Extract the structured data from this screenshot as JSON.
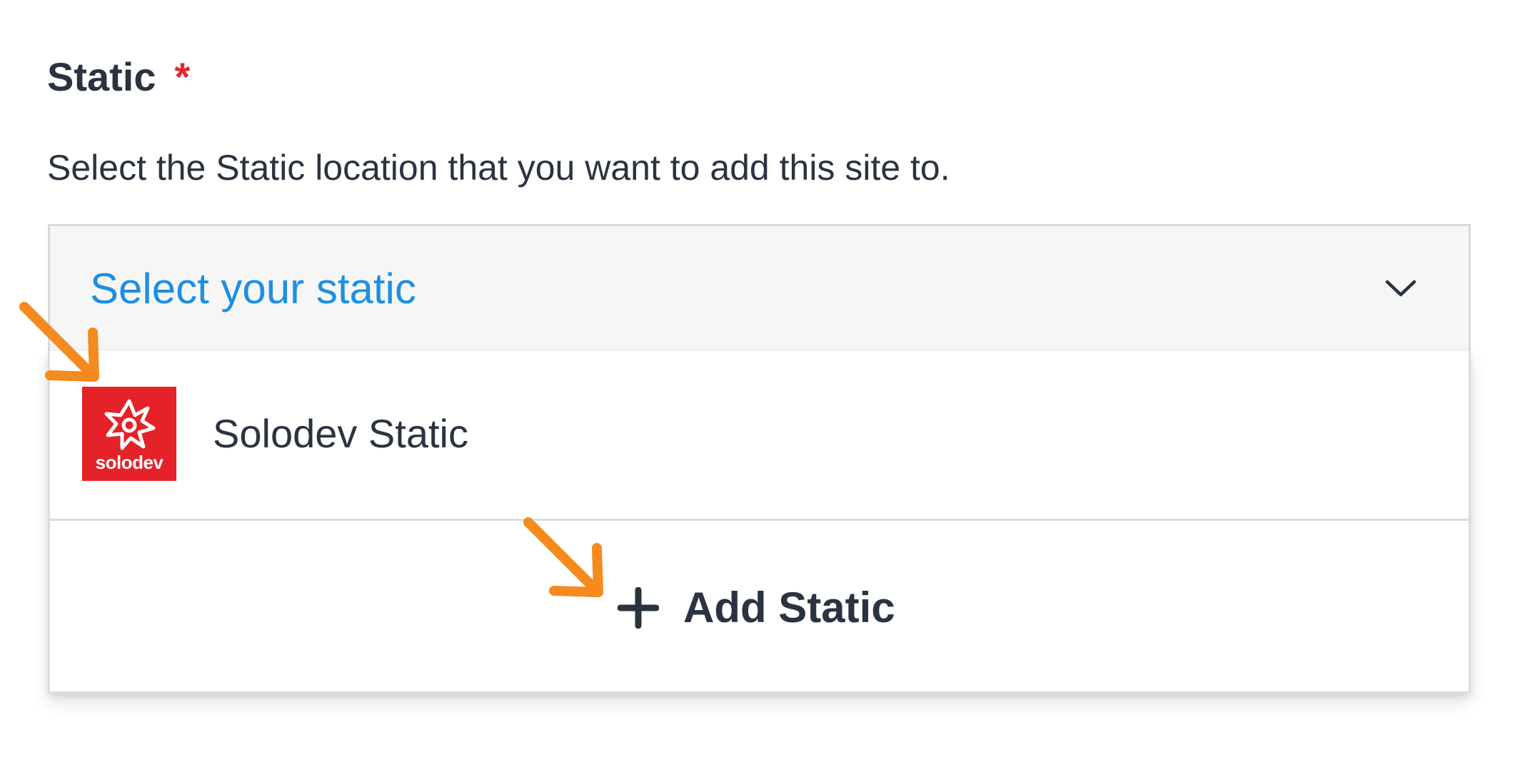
{
  "field": {
    "label": "Static",
    "required_marker": "*",
    "help_text": "Select the Static location that you want to add this site to."
  },
  "select": {
    "placeholder": "Select your static",
    "chevron_icon": "chevron-down-icon",
    "placeholder_color": "#1e8fe0"
  },
  "dropdown": {
    "options": [
      {
        "label": "Solodev Static",
        "logo_text": "solodev",
        "logo_icon": "solodev-logo-icon",
        "logo_color": "#e52228"
      }
    ],
    "add_button": {
      "label": "Add Static",
      "icon": "plus-icon"
    }
  },
  "annotations": {
    "arrow_color": "#f58a1f",
    "arrow_icon": "arrow-down-right-icon"
  },
  "colors": {
    "required": "#e0262e",
    "text": "#2b3340"
  }
}
